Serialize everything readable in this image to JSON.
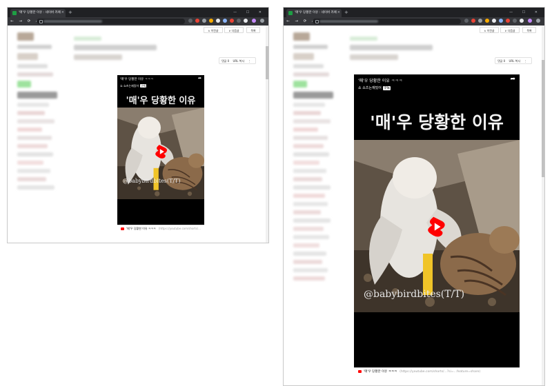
{
  "browser": {
    "tab_title": "'매'우 당황한 이유 : 네이버 카페",
    "tab_close": "×",
    "new_tab": "+",
    "window_controls": "— ☐ ✕",
    "nav_glyphs": "← → ⟳ ⌂"
  },
  "post_nav": {
    "prev_label": "∧ 이전글",
    "next_label": "∨ 다음글",
    "list_label": "목록"
  },
  "share": {
    "comment_label": "댓글 0",
    "url_copy_label": "URL 복사",
    "more_label": "⋮"
  },
  "embed": {
    "title": "'매'우 당황한 이유",
    "title_suffix": "ㅋㅋㅋ",
    "channel_name": "쇼츠는재밌어",
    "channel_avatar": "쇼",
    "subscribe_label": "구독",
    "share_icon": "➦",
    "headline": "'매'우 당황한 이유",
    "watermark": "@babybirdbites(T/T)",
    "footer_title": "'매'우 당황한 이유 ㅋㅋㅋ",
    "footer_url_a": "(https://youtube.com/shorts/...",
    "footer_url_b": "(https://youtube.com/shorts/...?si=...feature=share)"
  },
  "colors": {
    "chrome_dark": "#202124",
    "chrome_toolbar": "#35363a",
    "youtube_red": "#ff0000",
    "cafe_green": "#1e9e44",
    "embed_bg": "#000000"
  }
}
